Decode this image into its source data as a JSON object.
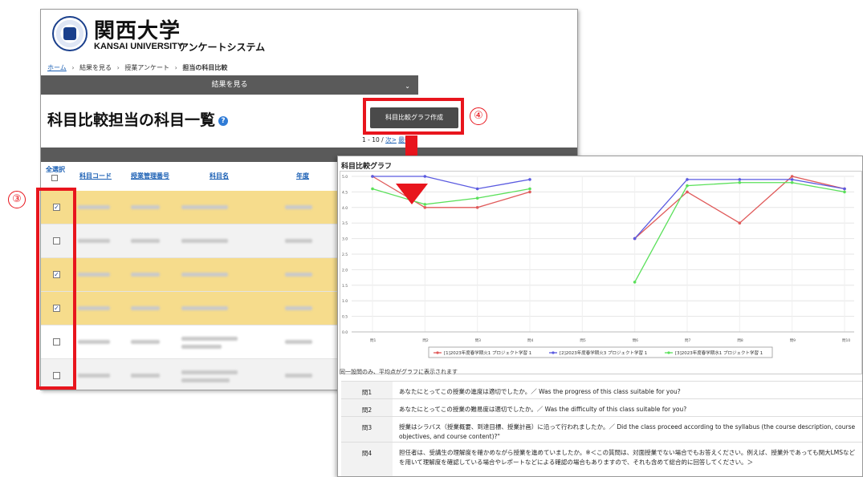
{
  "back_window": {
    "university_name_jp": "関西大学",
    "university_name_en": "KANSAI UNIVERSITY",
    "system_name": "アンケートシステム",
    "breadcrumb": [
      {
        "label": "ホーム",
        "link": true
      },
      {
        "label": "結果を見る",
        "link": false
      },
      {
        "label": "授業アンケート",
        "link": false
      },
      {
        "label": "担当の科目比較",
        "link": false,
        "current": true
      }
    ],
    "view_bar_label": "結果を見る",
    "page_title": "科目比較担当の科目一覧",
    "graph_button_label": "科目比較グラフ作成",
    "pager": {
      "range": "1 - 10 /",
      "next": "次>",
      "last": "最後»"
    },
    "table": {
      "select_all_label": "全選択",
      "columns": [
        "科目コード",
        "授業管理番号",
        "科目名",
        "年度"
      ]
    },
    "rows_checked": [
      true,
      false,
      true,
      true,
      false,
      false
    ]
  },
  "annotations": {
    "step_3": "③",
    "step_4": "④",
    "color": "#e8151d"
  },
  "front_window": {
    "title": "科目比較グラフ",
    "note": "同一設問のみ、平均点がグラフに表示されます",
    "questions": [
      {
        "id": "問1",
        "text": "あなたにとってこの授業の進度は適切でしたか。／ Was the progress of this class suitable for you?"
      },
      {
        "id": "問2",
        "text": "あなたにとってこの授業の難易度は適切でしたか。／ Was the difficulty of this class suitable for you?"
      },
      {
        "id": "問3",
        "text": "授業はシラバス（授業概要、到達目標、授業計画）に沿って行われましたか。／ Did the class proceed according to the syllabus (the course description, course objectives, and course content)?\""
      },
      {
        "id": "問4",
        "text": "担任者は、受講生の理解度を確かめながら授業を進めていましたか。※＜この質問は、対面授業でない場合でもお答えください。例えば、授業外であっても関大LMSなどを用いて理解度を確認している場合やレポートなどによる確認の場合もありますので、それも含めて総合的に回答してください。＞"
      }
    ]
  },
  "chart_data": {
    "type": "line",
    "title": "科目比較グラフ",
    "categories": [
      "問1",
      "問2",
      "問3",
      "問4",
      "問5",
      "問6",
      "問7",
      "問8",
      "問9",
      "問10"
    ],
    "yticks": [
      "0.0",
      "0.5",
      "1.0",
      "1.5",
      "2.0",
      "2.5",
      "3.0",
      "3.5",
      "4.0",
      "4.5",
      "5.0"
    ],
    "ylim": [
      0,
      5.0
    ],
    "grid": true,
    "legend_position": "bottom",
    "series": [
      {
        "name": "[1]2023年度春学期火1 プロジェクト学習 1",
        "color": "#e05a5a",
        "values": [
          5.0,
          4.0,
          4.0,
          4.5,
          null,
          3.0,
          4.5,
          3.5,
          5.0,
          4.6
        ]
      },
      {
        "name": "[2]2023年度春学期火3 プロジェクト学習 1",
        "color": "#5a5ae0",
        "values": [
          5.0,
          5.0,
          4.6,
          4.9,
          null,
          3.0,
          4.9,
          4.9,
          4.9,
          4.6
        ]
      },
      {
        "name": "[3]2023年度春学期水1 プロジェクト学習 1",
        "color": "#5ae05a",
        "values": [
          4.6,
          4.1,
          4.3,
          4.6,
          null,
          1.6,
          4.7,
          4.8,
          4.8,
          4.5
        ]
      }
    ]
  }
}
